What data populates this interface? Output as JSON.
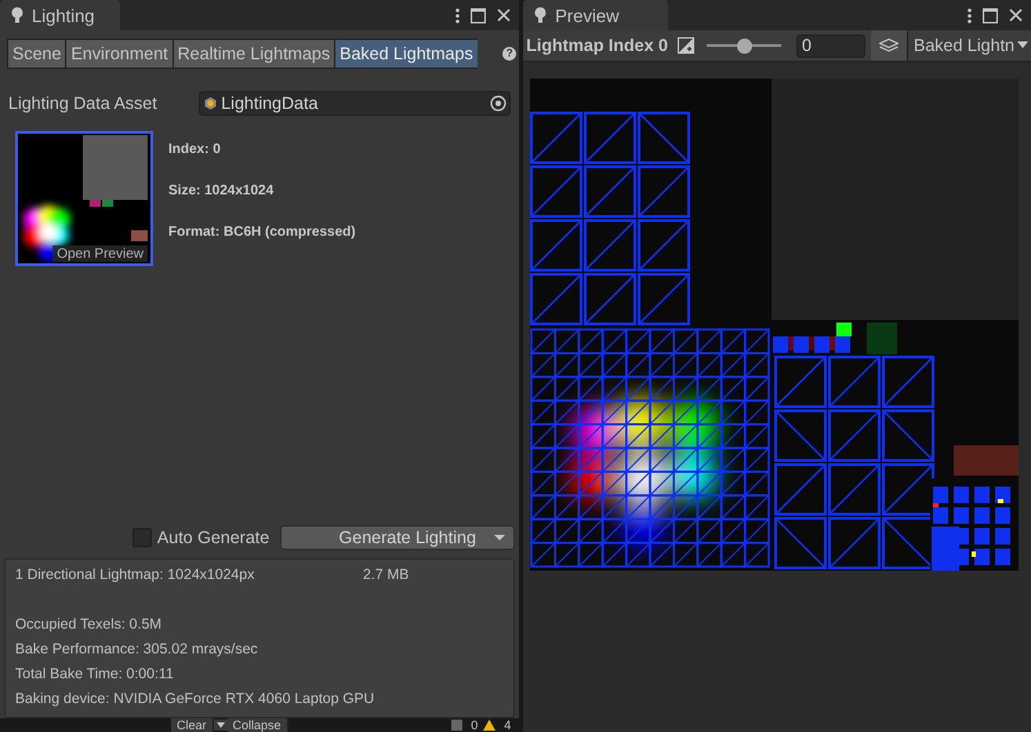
{
  "lighting_window": {
    "tab_title": "Lighting",
    "tabs": [
      {
        "label": "Scene",
        "selected": false
      },
      {
        "label": "Environment",
        "selected": false
      },
      {
        "label": "Realtime Lightmaps",
        "selected": false
      },
      {
        "label": "Baked Lightmaps",
        "selected": true
      }
    ],
    "help_icon": "?",
    "lighting_data_asset": {
      "label": "Lighting Data Asset",
      "value": "LightingData"
    },
    "lightmap_thumbnail": {
      "selected": true,
      "button": "Open Preview"
    },
    "info": [
      "Index: 0",
      "Size: 1024x1024",
      "Format: BC6H (compressed)"
    ],
    "auto_generate": {
      "label": "Auto Generate",
      "checked": false
    },
    "generate_button": "Generate Lighting",
    "stats": {
      "lightmap_summary": "1 Directional Lightmap: 1024x1024px",
      "memory": "2.7 MB",
      "lines": [
        "Occupied Texels: 0.5M",
        "Bake Performance: 305.02 mrays/sec",
        "Total Bake Time: 0:00:11",
        "Baking device: NVIDIA GeForce RTX 4060 Laptop GPU"
      ]
    }
  },
  "console_behind": {
    "buttons": [
      "Clear",
      "Collapse"
    ],
    "counts": [
      "0",
      "4"
    ]
  },
  "preview_window": {
    "tab_title": "Preview",
    "toolbar": {
      "title": "Lightmap Index 0",
      "slider": {
        "level": 0.5
      },
      "index_value": "0",
      "mode_dropdown": "Baked Lightn"
    }
  }
}
